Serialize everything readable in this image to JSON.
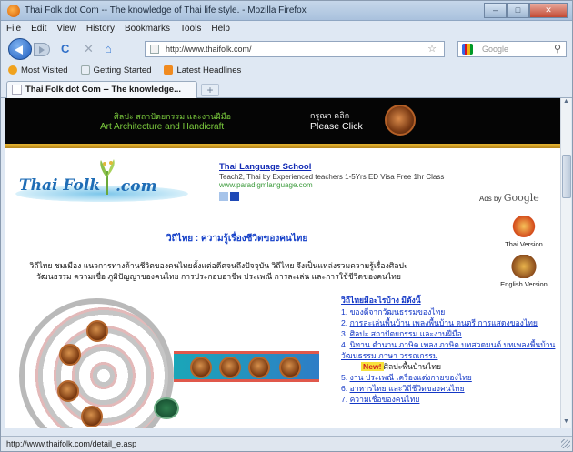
{
  "window": {
    "title": "Thai Folk dot Com -- The knowledge of Thai life style. - Mozilla Firefox",
    "controls": {
      "minimize": "–",
      "maximize": "□",
      "close": "✕"
    }
  },
  "menu": [
    "File",
    "Edit",
    "View",
    "History",
    "Bookmarks",
    "Tools",
    "Help"
  ],
  "nav": {
    "url": "http://www.thaifolk.com/",
    "search_placeholder": "Google",
    "icons": {
      "reload": "C",
      "stop": "✕",
      "home": "⌂",
      "star": "☆",
      "search": "⚲"
    }
  },
  "bookmarks": [
    {
      "label": "Most Visited",
      "icon": "star-icon",
      "color": "#f0a21e"
    },
    {
      "label": "Getting Started",
      "icon": "page-icon",
      "color": "#e8eef5"
    },
    {
      "label": "Latest Headlines",
      "icon": "rss-icon",
      "color": "#f08a1e"
    }
  ],
  "tabs": [
    {
      "label": "Thai Folk dot Com -- The knowledge..."
    }
  ],
  "new_tab": "+",
  "page": {
    "banner": {
      "thai_line": "ศิลปะ สถาปัตยกรรม และงานฝีมือ",
      "english_line": "Art Architecture and Handicraft",
      "cta_thai": "กรุณา คลิก",
      "cta_english": "Please Click"
    },
    "logo": {
      "part1": "Thai Folk",
      "part2": ".com"
    },
    "ad": {
      "title": "Thai Language School",
      "text": "Teach2, Thai by Experienced teachers 1-5Yrs ED Visa Free 1hr Class",
      "url": "www.paradigmlanguage.com"
    },
    "ads_by": "Ads by",
    "ads_brand": "Google",
    "heading": "วิถีไทย  :  ความรู้เรื่องชีวิตของคนไทย",
    "description": "วิถีไทย ชมเมือง แนวการทางด้านชีวิตของคนไทยตั้งแต่อดีตจนถึงปัจจุบัน วิถีไทย จึงเป็นแหล่งรวมความรู้เรื่องศิลปะ วัฒนธรรม ความเชื่อ ภูมิปัญญาของคนไทย การประกอบอาชีพ ประเพณี การละเล่น และการใช้ชีวิตของคนไทย",
    "thai_version": "Thai Version",
    "english_version": "English Version",
    "links": {
      "header": "วิถีไทยมีอะไรบ้าง มีดังนี้",
      "items": [
        {
          "num": "1.",
          "text": "ของดีจากวัฒนธรรมของไทย"
        },
        {
          "num": "2.",
          "text": "การละเล่นพื้นบ้าน เพลงพื้นบ้าน ดนตรี การแสดงของไทย"
        },
        {
          "num": "3.",
          "text": "ศิลปะ สถาปัตยกรรม และงานฝีมือ"
        },
        {
          "num": "4.",
          "text": "นิทาน ตำนาน ภาษิต เพลง ภาษิต บทสวดมนต์ บทเพลงพื้นบ้าน"
        }
      ],
      "sub": "วัฒนธรรม ภาษา วรรณกรรม",
      "new_badge": "New!",
      "new_text": "ศิลปะพื้นบ้านไทย",
      "items2": [
        {
          "num": "5.",
          "text": "งาน ประเพณี เครื่องแต่งกายของไทย"
        },
        {
          "num": "6.",
          "text": "อาหารไทย และวิถีชีวิตของคนไทย"
        },
        {
          "num": "7.",
          "text": "ความเชื่อของคนไทย"
        }
      ]
    }
  },
  "status": "http://www.thaifolk.com/detail_e.asp"
}
